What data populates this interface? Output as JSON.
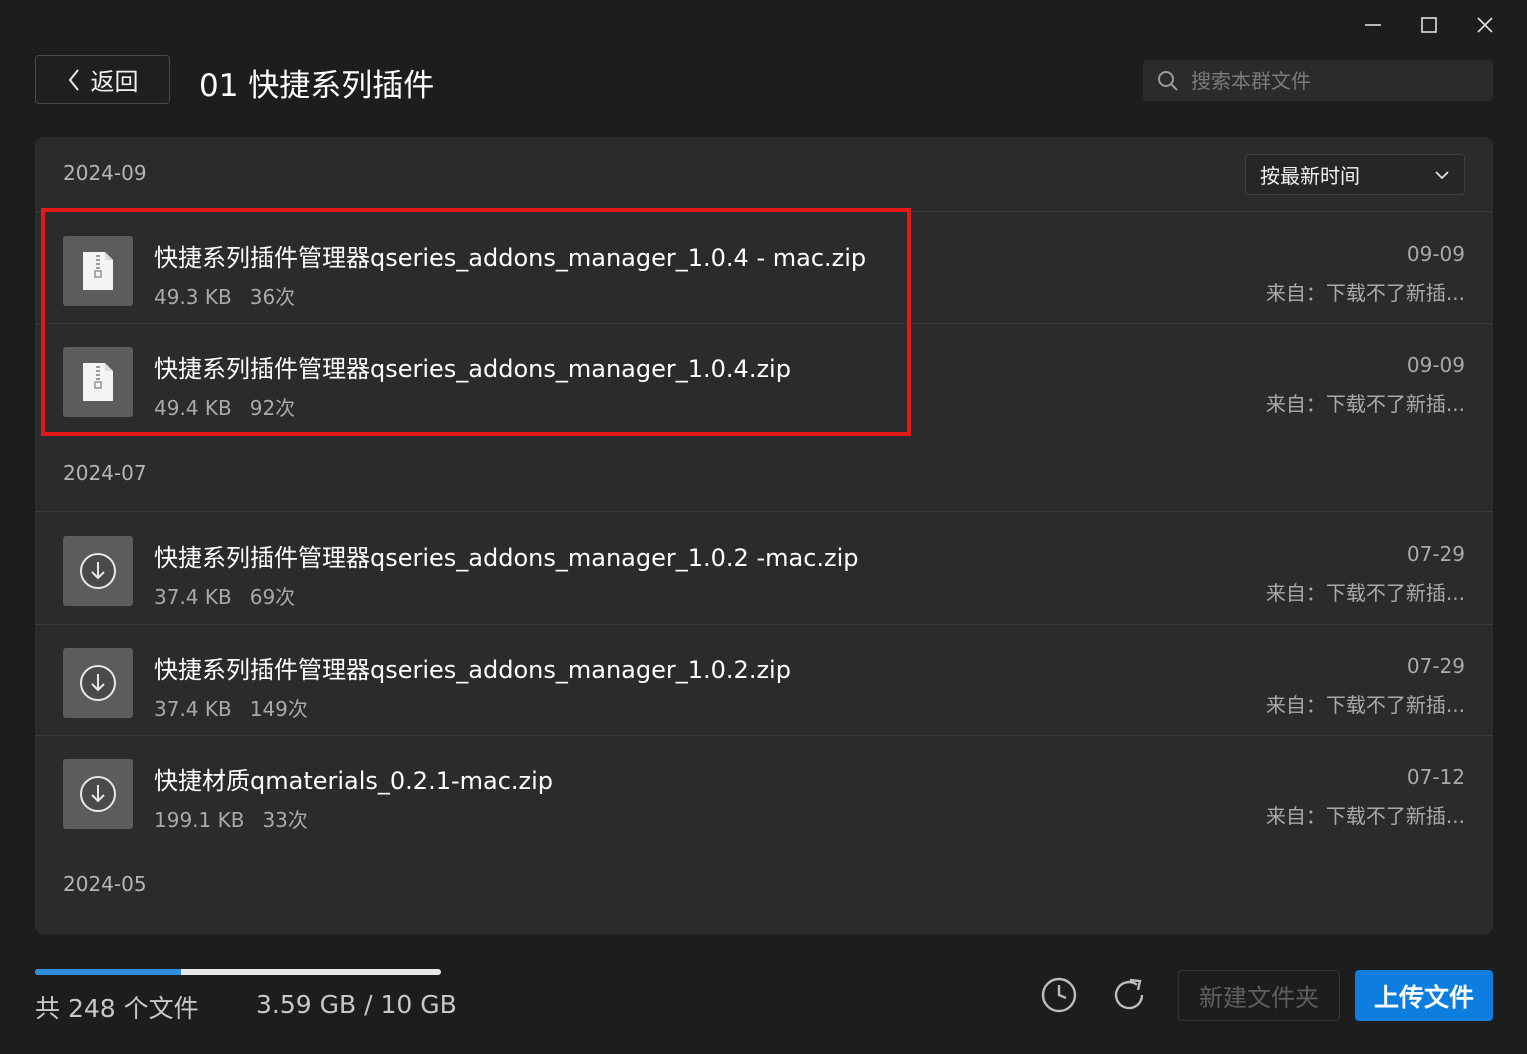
{
  "header": {
    "back_label": "返回",
    "title": "01 快捷系列插件",
    "search_placeholder": "搜索本群文件"
  },
  "sort": {
    "selected": "按最新时间"
  },
  "groups": [
    {
      "label": "2024-09",
      "files": [
        {
          "name": "快捷系列插件管理器qseries_addons_manager_1.0.4 - mac.zip",
          "size": "49.3 KB",
          "downloads": "36次",
          "date": "09-09",
          "from": "来自：下载不了新插...",
          "icon": "zip-file-icon"
        },
        {
          "name": "快捷系列插件管理器qseries_addons_manager_1.0.4.zip",
          "size": "49.4 KB",
          "downloads": "92次",
          "date": "09-09",
          "from": "来自：下载不了新插...",
          "icon": "zip-file-icon"
        }
      ]
    },
    {
      "label": "2024-07",
      "files": [
        {
          "name": "快捷系列插件管理器qseries_addons_manager_1.0.2 -mac.zip",
          "size": "37.4 KB",
          "downloads": "69次",
          "date": "07-29",
          "from": "来自：下载不了新插...",
          "icon": "download-pending-icon"
        },
        {
          "name": "快捷系列插件管理器qseries_addons_manager_1.0.2.zip",
          "size": "37.4 KB",
          "downloads": "149次",
          "date": "07-29",
          "from": "来自：下载不了新插...",
          "icon": "download-pending-icon"
        },
        {
          "name": "快捷材质qmaterials_0.2.1-mac.zip",
          "size": "199.1 KB",
          "downloads": "33次",
          "date": "07-12",
          "from": "来自：下载不了新插...",
          "icon": "download-pending-icon"
        }
      ]
    },
    {
      "label": "2024-05",
      "files": []
    }
  ],
  "footer": {
    "file_count": "共 248 个文件",
    "storage": "3.59 GB / 10 GB",
    "storage_used_fraction": 0.359,
    "new_folder_label": "新建文件夹",
    "upload_label": "上传文件"
  },
  "colors": {
    "accent": "#0d7ee0",
    "progress": "#2f8fdc",
    "highlight": "#e31818"
  }
}
